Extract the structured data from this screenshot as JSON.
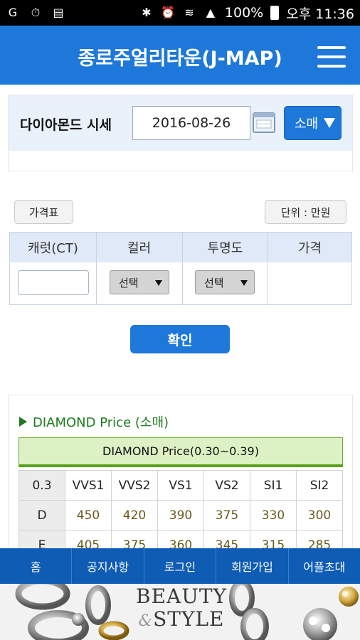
{
  "status_bar": {
    "battery": "100%",
    "time": "오후 11:36",
    "icons": [
      "g-app-icon",
      "alarm-icon",
      "sim-icon",
      "bluetooth-icon",
      "alarm-clock-icon",
      "wifi-icon",
      "signal-icon",
      "battery-icon"
    ]
  },
  "header": {
    "title": "종로주얼리타운(J-MAP)",
    "menu_icon": "hamburger-menu-icon"
  },
  "date_panel": {
    "label": "다이아몬드 시세",
    "date_value": "2016-08-26",
    "calendar_icon": "calendar-icon",
    "type_dropdown": "소매"
  },
  "buttons": {
    "price_table": "가격표",
    "unit": "단위 : 만원",
    "confirm": "확인"
  },
  "search_table": {
    "headers": [
      "캐럿(CT)",
      "컬러",
      "투명도",
      "가격"
    ],
    "carat_value": "",
    "color_select": "선택",
    "clarity_select": "선택",
    "price_value": ""
  },
  "price_section": {
    "heading": "DIAMOND Price (소매)",
    "table_title": "DIAMOND Price(0.30~0.39)",
    "columns": [
      "0.3",
      "VVS1",
      "VVS2",
      "VS1",
      "VS2",
      "SI1",
      "SI2"
    ],
    "rows": [
      {
        "label": "D",
        "values": [
          "450",
          "420",
          "390",
          "375",
          "330",
          "300"
        ]
      },
      {
        "label": "E",
        "values": [
          "405",
          "375",
          "360",
          "345",
          "315",
          "285"
        ]
      }
    ]
  },
  "bottom_nav": [
    "홈",
    "공지사항",
    "로그인",
    "회원가입",
    "어플초대"
  ],
  "banner": {
    "line1": "BEAUTY",
    "amp": "&",
    "line2": "STYLE"
  },
  "colors": {
    "primary_blue": "#1d78d9",
    "nav_blue": "#0f5cb5",
    "green_heading": "#1f7a1f",
    "table_title_bg": "#dcf1c4"
  }
}
